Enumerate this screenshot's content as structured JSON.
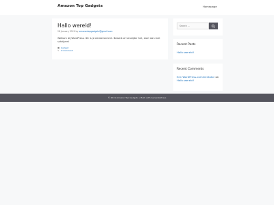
{
  "header": {
    "site_title": "Amazon Top Gadgets",
    "nav": [
      {
        "label": "Homepage"
      }
    ]
  },
  "post": {
    "title": "Hallo wereld!",
    "date": "28 January 2021",
    "by": "by",
    "author": "amazontopgadgets@gmail.com",
    "content": "Welkom bij WordPress. Dit is je eerste bericht. Bewerk of verwijder het, start dan met schrijven!",
    "category": "Gadget",
    "comments": "1 Comment"
  },
  "sidebar": {
    "search": {
      "placeholder": "Search ..."
    },
    "recent_posts": {
      "title": "Recent Posts",
      "items": [
        {
          "label": "Hallo wereld!"
        }
      ]
    },
    "recent_comments": {
      "title": "Recent Comments",
      "commenter": "Een WordPress-commentator",
      "on": "on",
      "post": "Hallo wereld!"
    }
  },
  "footer": {
    "text": "© 2021 Amazon Top Gadgets • Built with GeneratePress"
  },
  "colors": {
    "background": "#f7f8f9",
    "link": "#1e73be",
    "footer_bg": "#55555e"
  },
  "icons": {
    "category": "folder-icon",
    "comments": "comment-icon",
    "search": "search-icon"
  }
}
